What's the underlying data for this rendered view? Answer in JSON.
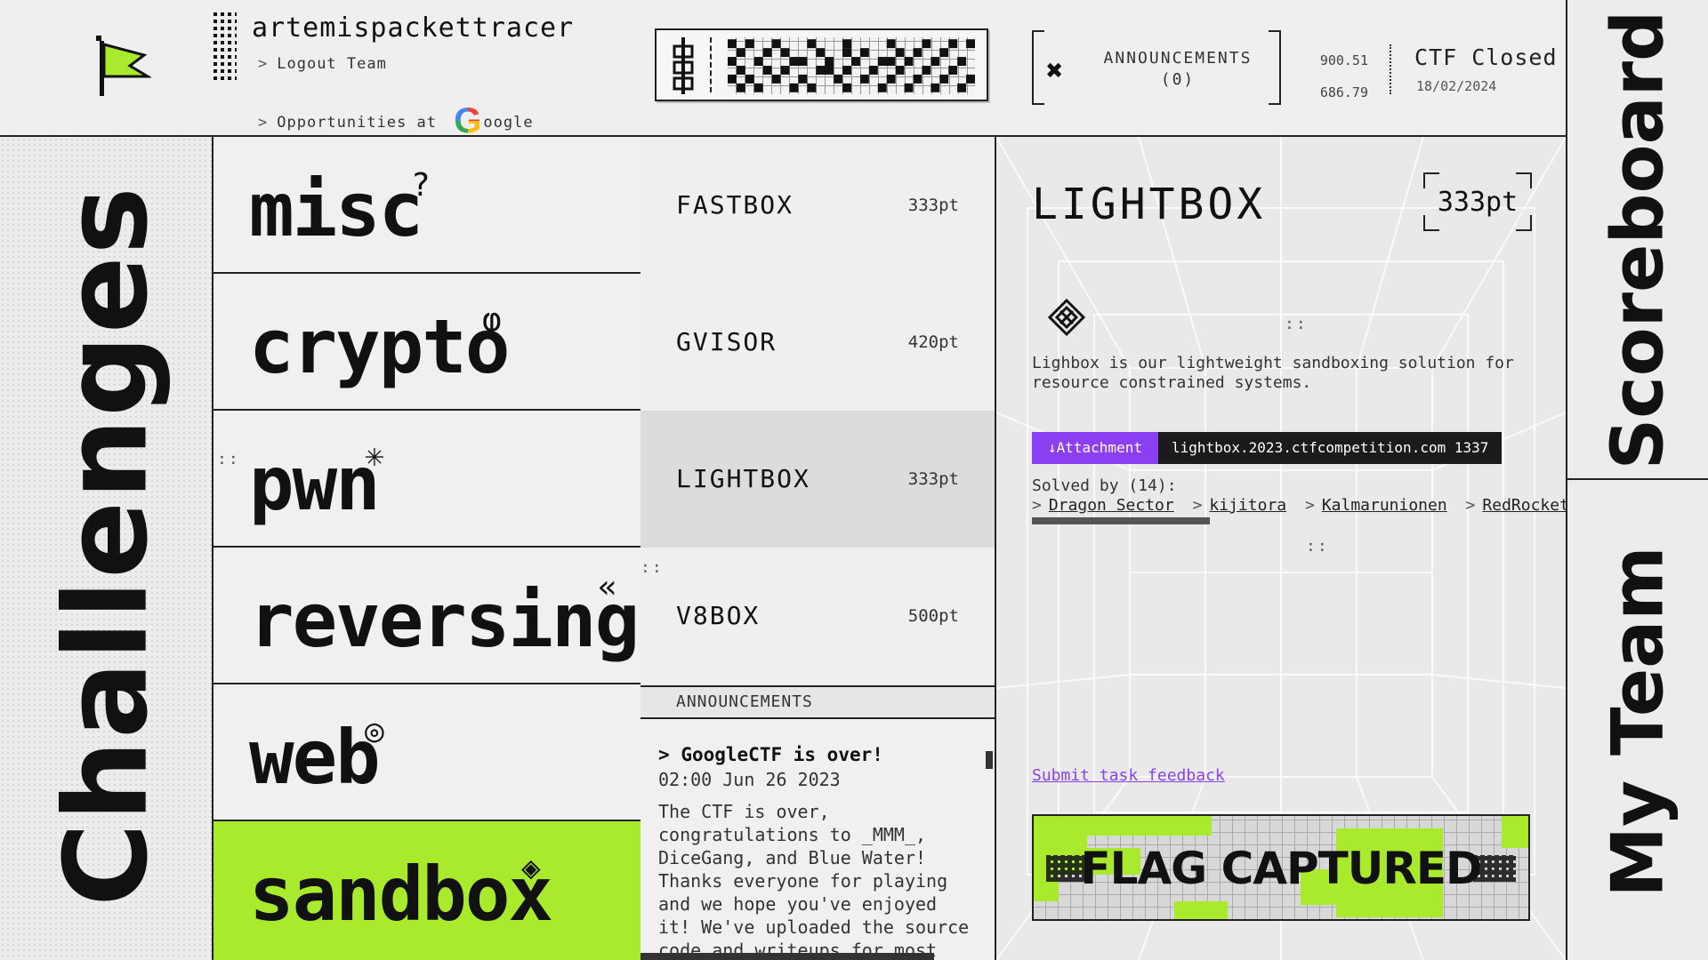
{
  "header": {
    "username": "artemispackettracer",
    "logout_link": "Logout Team",
    "opportunities_text": "Opportunities at ",
    "google_g": "G",
    "google_rest": "oogle",
    "announcements_label": "ANNOUNCEMENTS",
    "announcements_count": "(0)",
    "coord_top": "900.51",
    "coord_bottom": "686.79",
    "ctf_status": "CTF Closed",
    "ctf_date": "18/02/2024",
    "chevron": ">"
  },
  "sidebar_title": "Challenges",
  "categories": [
    {
      "label": "misc",
      "mark": "?"
    },
    {
      "label": "crypto",
      "mark": "φ"
    },
    {
      "label": "pwn",
      "mark": "✳"
    },
    {
      "label": "reversing",
      "mark": "«"
    },
    {
      "label": "web",
      "mark": "◎"
    },
    {
      "label": "sandbox",
      "mark": "◈",
      "active": true
    }
  ],
  "challenges": [
    {
      "name": "FASTBOX",
      "points": "333pt"
    },
    {
      "name": "GVISOR",
      "points": "420pt"
    },
    {
      "name": "LIGHTBOX",
      "points": "333pt",
      "selected": true
    },
    {
      "name": "V8BOX",
      "points": "500pt"
    }
  ],
  "announcements": {
    "header": "ANNOUNCEMENTS",
    "title": "GoogleCTF is over!",
    "time": "02:00 Jun 26 2023",
    "body": "The CTF is over, congratulations to _MMM_, DiceGang, and Blue Water! Thanks everyone for playing and we hope you've enjoyed it! We've uploaded the source code and writeups for most"
  },
  "detail": {
    "title": "LIGHTBOX",
    "points": "333pt",
    "description": "Lighbox is our lightweight sandboxing solution for resource constrained systems.",
    "attachment_label": "↓Attachment",
    "server": "lightbox.2023.ctfcompetition.com 1337",
    "solved_label": "Solved by (14):",
    "solvers": [
      "Dragon Sector",
      "kijitora",
      "Kalmarunionen",
      "RedRocket"
    ],
    "feedback_link": "Submit task feedback",
    "flag_banner": "FLAG CAPTURED"
  },
  "nav": {
    "scoreboard": "Scoreboard",
    "my_team": "My Team"
  },
  "colors": {
    "accent_lime": "#aaea2c",
    "accent_purple": "#8a3ff2",
    "ink": "#111111"
  }
}
